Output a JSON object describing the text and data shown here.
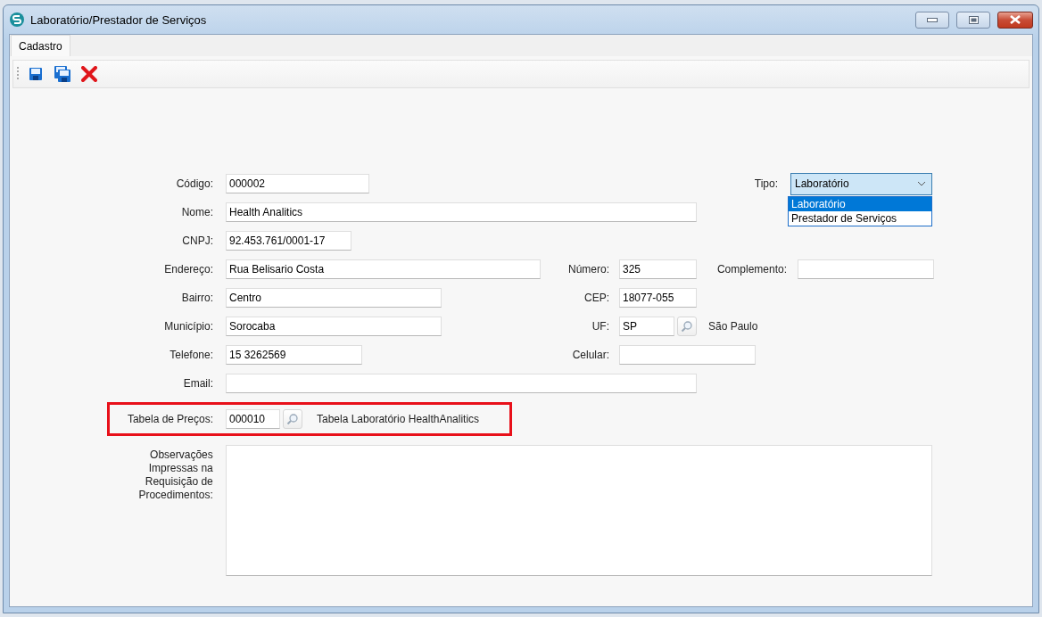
{
  "window": {
    "title": "Laboratório/Prestador de Serviços"
  },
  "tabs": [
    {
      "label": "Cadastro",
      "selected": true
    }
  ],
  "form": {
    "codigo": {
      "label": "Código:",
      "value": "000002"
    },
    "tipo": {
      "label": "Tipo:",
      "value": "Laboratório",
      "expanded": true,
      "options": [
        {
          "label": "Laboratório",
          "selected": true
        },
        {
          "label": "Prestador de Serviços",
          "selected": false
        }
      ]
    },
    "nome": {
      "label": "Nome:",
      "value": "Health Analitics"
    },
    "cnpj": {
      "label": "CNPJ:",
      "value": "92.453.761/0001-17"
    },
    "endereco": {
      "label": "Endereço:",
      "value": "Rua Belisario Costa"
    },
    "numero": {
      "label": "Número:",
      "value": "325"
    },
    "complemento": {
      "label": "Complemento:"
    },
    "bairro": {
      "label": "Bairro:",
      "value": "Centro"
    },
    "cep": {
      "label": "CEP:",
      "value": "18077-055"
    },
    "municipio": {
      "label": "Município:",
      "value": "Sorocaba"
    },
    "uf": {
      "label": "UF:",
      "value": "SP",
      "description": "São Paulo"
    },
    "telefone": {
      "label": "Telefone:",
      "value": "15 3262569"
    },
    "celular": {
      "label": "Celular:"
    },
    "email": {
      "label": "Email:"
    },
    "tabela_precos": {
      "label": "Tabela de Preços:",
      "value": "000010",
      "description": "Tabela Laboratório HealthAnalitics",
      "highlighted": true
    },
    "observacoes": {
      "label": "Observações Impressas na Requisição de Procedimentos:"
    }
  }
}
